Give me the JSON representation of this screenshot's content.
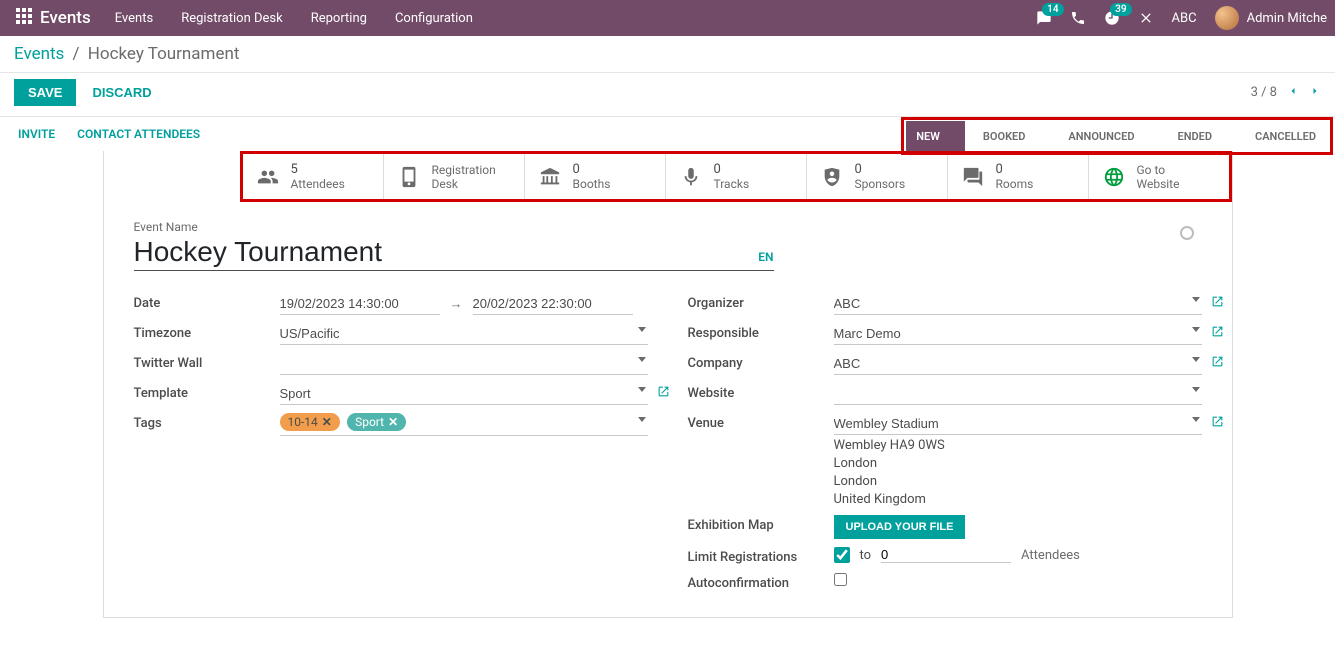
{
  "topnav": {
    "brand": "Events",
    "menu": [
      "Events",
      "Registration Desk",
      "Reporting",
      "Configuration"
    ],
    "msg_badge": "14",
    "timer_badge": "39",
    "company": "ABC",
    "user": "Admin Mitche"
  },
  "breadcrumb": {
    "root": "Events",
    "current": "Hockey Tournament"
  },
  "buttons": {
    "save": "SAVE",
    "discard": "DISCARD",
    "invite": "INVITE",
    "contact": "CONTACT ATTENDEES"
  },
  "pager": {
    "text": "3 / 8"
  },
  "status": [
    "NEW",
    "BOOKED",
    "ANNOUNCED",
    "ENDED",
    "CANCELLED"
  ],
  "stats": [
    {
      "num": "5",
      "label": "Attendees"
    },
    {
      "num": "",
      "label1": "Registration",
      "label2": "Desk"
    },
    {
      "num": "0",
      "label": "Booths"
    },
    {
      "num": "0",
      "label": "Tracks"
    },
    {
      "num": "0",
      "label": "Sponsors"
    },
    {
      "num": "0",
      "label": "Rooms"
    },
    {
      "num": "",
      "label1": "Go to",
      "label2": "Website"
    }
  ],
  "form": {
    "title_label": "Event Name",
    "title": "Hockey Tournament",
    "lang": "EN",
    "labels": {
      "date": "Date",
      "timezone": "Timezone",
      "twitter": "Twitter Wall",
      "template": "Template",
      "tags": "Tags",
      "organizer": "Organizer",
      "responsible": "Responsible",
      "company": "Company",
      "website": "Website",
      "venue": "Venue",
      "exmap": "Exhibition Map",
      "limit": "Limit Registrations",
      "autoconf": "Autoconfirmation"
    },
    "date_start": "19/02/2023 14:30:00",
    "date_end": "20/02/2023 22:30:00",
    "timezone": "US/Pacific",
    "twitter": "",
    "template": "Sport",
    "tags": [
      {
        "text": "10-14",
        "color": "orange"
      },
      {
        "text": "Sport",
        "color": "teal"
      }
    ],
    "organizer": "ABC",
    "responsible": "Marc Demo",
    "company": "ABC",
    "website": "",
    "venue": "Wembley Stadium",
    "address": [
      "Wembley HA9 0WS",
      "London",
      "London",
      "United Kingdom"
    ],
    "upload": "UPLOAD YOUR FILE",
    "limit_checked": true,
    "limit_to": "to",
    "limit_val": "0",
    "limit_suffix": "Attendees",
    "autoconf_checked": false
  }
}
